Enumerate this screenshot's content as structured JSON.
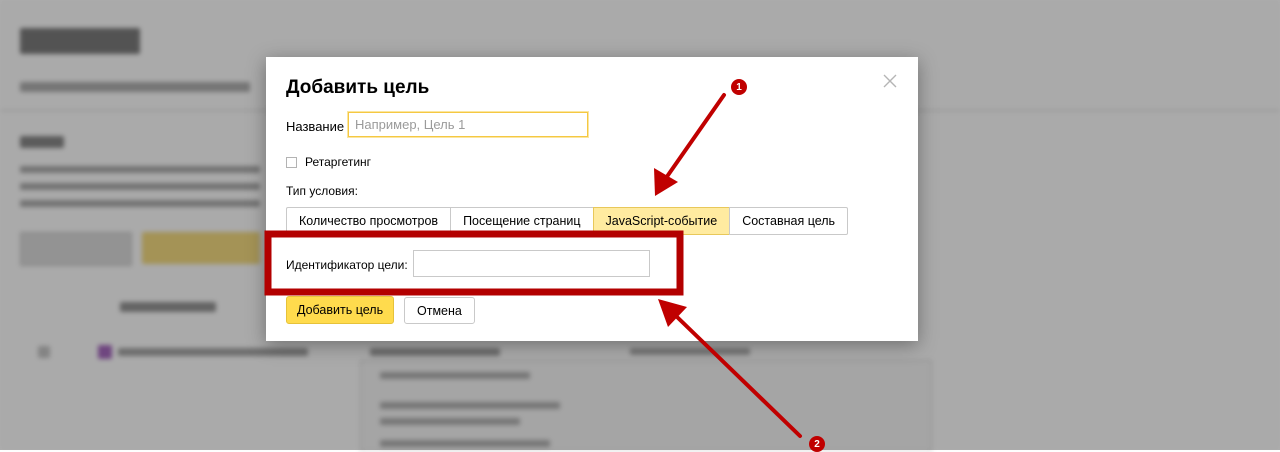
{
  "modal": {
    "title": "Добавить цель",
    "name_label": "Название",
    "name_placeholder": "Например, Цель 1",
    "retargeting_label": "Ретаргетинг",
    "retargeting_checked": false,
    "condition_type_label": "Тип условия:",
    "tabs": [
      {
        "label": "Количество просмотров",
        "active": false
      },
      {
        "label": "Посещение страниц",
        "active": false
      },
      {
        "label": "JavaScript-событие",
        "active": true
      },
      {
        "label": "Составная цель",
        "active": false
      }
    ],
    "goal_id_label": "Идентификатор цели:",
    "goal_id_value": "",
    "add_button": "Добавить цель",
    "cancel_button": "Отмена"
  },
  "annotations": {
    "badge_1": "1",
    "badge_2": "2"
  },
  "colors": {
    "accent_yellow": "#ffdb4d",
    "active_tab": "#ffeba0",
    "annotation_red": "#c00000"
  },
  "icons": {
    "close": "close-icon"
  }
}
